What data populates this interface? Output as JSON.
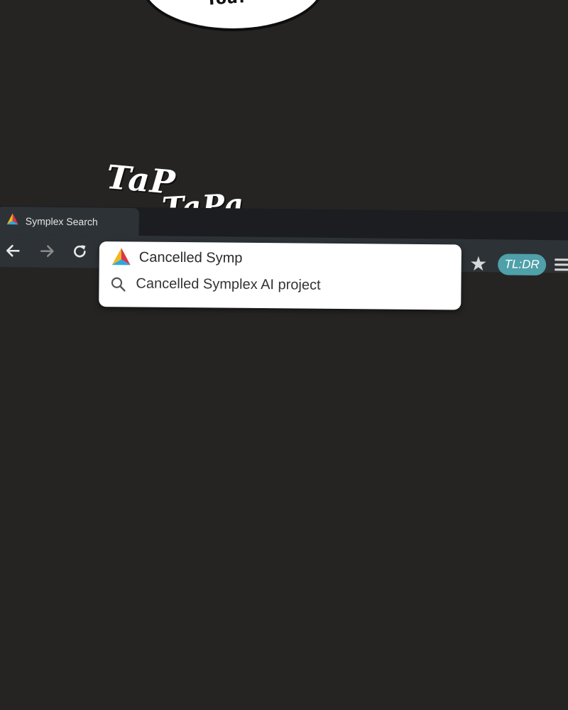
{
  "comic": {
    "bubble_text": "You?",
    "sfx_1": "TaP",
    "sfx_2": "TaPa"
  },
  "browser": {
    "tab": {
      "title": "Symplex Search",
      "icon": "symplex-logo-icon"
    },
    "nav": {
      "back_icon": "arrow-left-icon",
      "forward_icon": "arrow-right-icon",
      "reload_icon": "reload-icon"
    },
    "omnibox": {
      "value": "Cancelled Symp",
      "suggestions": [
        {
          "icon": "search-icon",
          "text": "Cancelled Symplex AI project"
        }
      ]
    },
    "bookmark_icon": "star-icon",
    "extension_label": "TL:DR",
    "menu_icon": "hamburger-menu-icon"
  },
  "colors": {
    "background": "#252423",
    "toolbar": "#2d3236",
    "tab_strip": "#1c1d20",
    "extension": "#4fa0a8",
    "logo_yellow": "#f2b71c",
    "logo_red": "#d8364a",
    "logo_blue": "#2ea8e0"
  }
}
